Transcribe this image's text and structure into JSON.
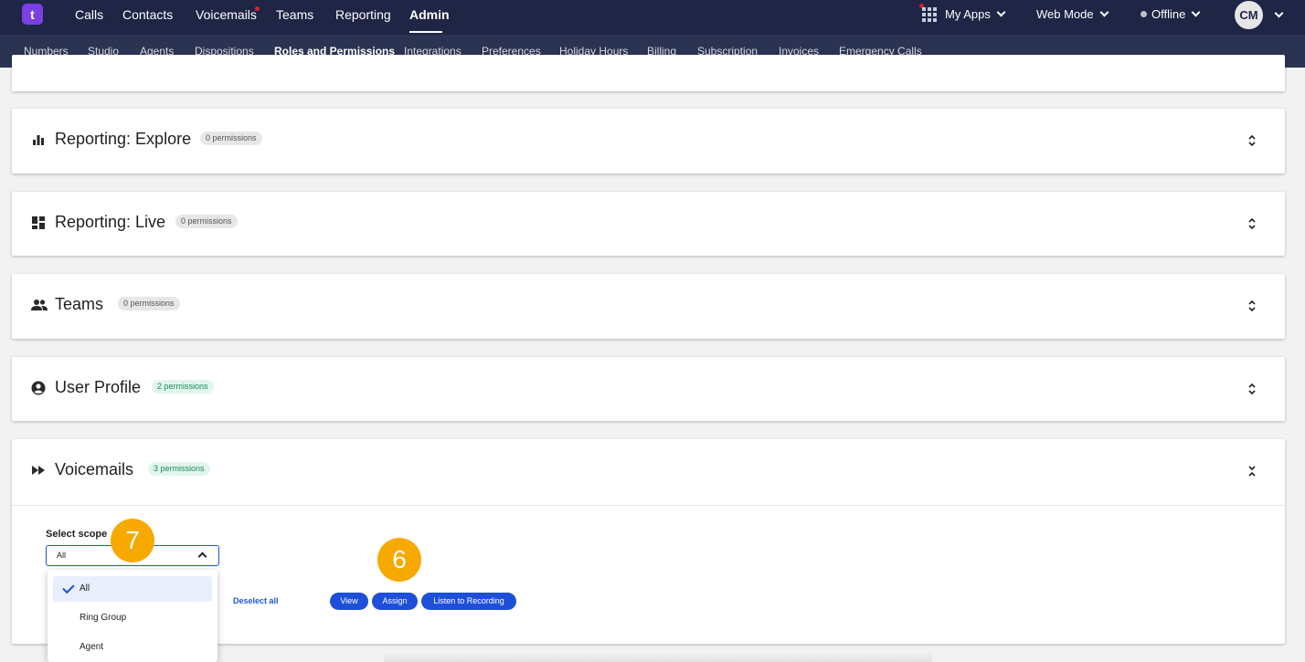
{
  "colors": {
    "topbar": "#1e2545",
    "subbar": "#2b3352",
    "accent": "#1e4fd8",
    "brand": "#7b3fe4",
    "marker": "#f7a900"
  },
  "topnav": {
    "logo": "t",
    "items": [
      "Calls",
      "Contacts",
      "Voicemails",
      "Teams",
      "Reporting",
      "Admin"
    ],
    "active": "Admin",
    "my_apps": "My Apps",
    "mode": "Web Mode",
    "status": "Offline",
    "avatar": "CM"
  },
  "subnav": {
    "items": [
      "Numbers",
      "Studio",
      "Agents",
      "Dispositions",
      "Roles and Permissions",
      "Integrations",
      "Preferences",
      "Holiday Hours",
      "Billing",
      "Subscription",
      "Invoices",
      "Emergency Calls"
    ],
    "active": "Roles and Permissions"
  },
  "sections": [
    {
      "title": "Reporting: Explore",
      "badge": "0 permissions",
      "icon": "bar-chart-icon"
    },
    {
      "title": "Reporting: Live",
      "badge": "0 permissions",
      "icon": "dashboard-icon"
    },
    {
      "title": "Teams",
      "badge": "0 permissions",
      "icon": "people-icon"
    },
    {
      "title": "User Profile",
      "badge": "2 permissions",
      "icon": "account-circle-icon"
    },
    {
      "title": "Voicemails",
      "badge": "3 permissions",
      "icon": "fast-forward-icon"
    }
  ],
  "voicemails_panel": {
    "scope_label": "Select scope",
    "scope_value": "All",
    "deselect_all": "Deselect all",
    "permissions": [
      "View",
      "Assign",
      "Listen to Recording"
    ],
    "scope_options": [
      "All",
      "Ring Group",
      "Agent"
    ],
    "selected_option": "All"
  },
  "markers": {
    "select_scope": "7",
    "permissions": "6"
  }
}
